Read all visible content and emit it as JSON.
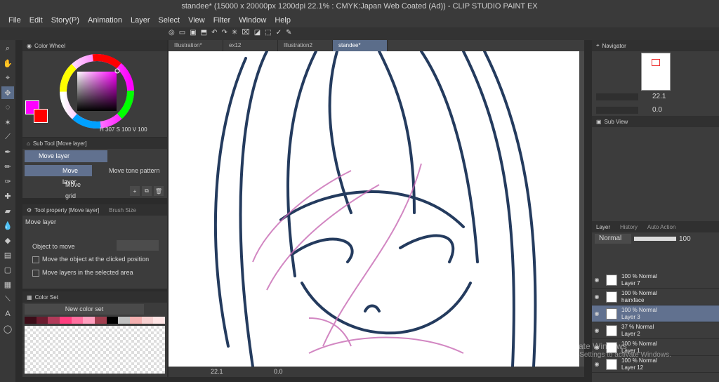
{
  "window": {
    "title": "standee* (15000 x 20000px 1200dpi 22.1% : CMYK:Japan Web Coated (Ad)) - CLIP STUDIO PAINT EX"
  },
  "menu": [
    "File",
    "Edit",
    "Story(P)",
    "Animation",
    "Layer",
    "Select",
    "View",
    "Filter",
    "Window",
    "Help"
  ],
  "tabs": [
    {
      "label": "Illustration*",
      "active": false
    },
    {
      "label": "ex12",
      "active": false
    },
    {
      "label": "Illustration2",
      "active": false
    },
    {
      "label": "standee*",
      "active": true
    }
  ],
  "color_wheel": {
    "title": "Color Wheel",
    "hsv": "H 307 S 100 V 100"
  },
  "sub_tool": {
    "title": "Sub Tool [Move layer]",
    "group": "Move layer",
    "items": [
      "Move layer",
      "Move tone pattern",
      "Move grid"
    ]
  },
  "tool_property": {
    "title": "Tool property [Move layer]",
    "brush_size_tab": "Brush Size",
    "name": "Move layer",
    "object_to_move": "Object to move",
    "option1": "Move the object at the clicked position",
    "option2": "Move layers in the selected area"
  },
  "color_set": {
    "title": "Color Set",
    "set_name": "New color set"
  },
  "canvas": {
    "zoom": "22.1",
    "rotation": "0.0"
  },
  "navigator": {
    "title": "Navigator",
    "zoom": "22.1",
    "rotation": "0.0"
  },
  "subview": {
    "title": "Sub View"
  },
  "layer_panel": {
    "tab": "Layer",
    "history": "History",
    "auto_action": "Auto Action",
    "blend": "Normal",
    "opacity": "100",
    "layers": [
      {
        "line1": "100 % Normal",
        "line2": "Layer 7",
        "selected": false
      },
      {
        "line1": "100 % Normal",
        "line2": "hairxface",
        "selected": false
      },
      {
        "line1": "100 % Normal",
        "line2": "Layer 3",
        "selected": true
      },
      {
        "line1": "37 % Normal",
        "line2": "Layer 2",
        "selected": false
      },
      {
        "line1": "100 % Normal",
        "line2": "Layer 1",
        "selected": false
      },
      {
        "line1": "100 % Normal",
        "line2": "Layer 12",
        "selected": false
      }
    ]
  },
  "watermark": {
    "line1": "Activate Windows",
    "line2": "Go to Settings to activate Windows."
  },
  "colors": {
    "main": "#ff00ff",
    "sub": "#ff0000",
    "line": "#243b5e",
    "sketch": "#c86ab4"
  }
}
